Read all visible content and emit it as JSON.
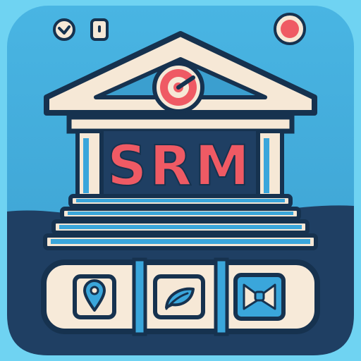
{
  "app_icon": {
    "label": "SRM",
    "colors": {
      "background_light": "#5ec8ea",
      "background_mid": "#3b9fcf",
      "wave_dark": "#1f3f63",
      "outline": "#16324f",
      "cream": "#f6e8d6",
      "accent_red": "#ef5a64",
      "step_blue": "#3aa6db",
      "tile_cream": "#f7ead9"
    }
  },
  "status_bar": {
    "icons": [
      "clock-icon",
      "battery-icon",
      "notification-dot-icon"
    ]
  },
  "pediment_badge": {
    "icon": "gauge-icon"
  },
  "dock": {
    "items": [
      {
        "icon": "location-pin-icon"
      },
      {
        "icon": "leaf-chat-icon"
      },
      {
        "icon": "bow-tie-icon"
      }
    ]
  }
}
